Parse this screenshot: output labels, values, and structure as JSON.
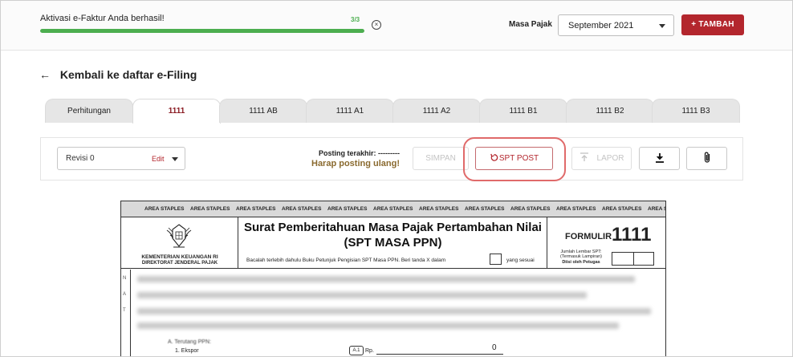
{
  "notification": {
    "message": "Aktivasi e-Faktur Anda berhasil!",
    "step_count": "3/3",
    "progress": 1.0
  },
  "header": {
    "masa_pajak_label": "Masa Pajak",
    "masa_pajak_value": "September  2021",
    "tambah_label": "TAMBAH",
    "tambah_icon": "+"
  },
  "back_link": {
    "arrow": "←",
    "label": "Kembali ke daftar e-Filing"
  },
  "tabs": [
    {
      "label": "Perhitungan",
      "active": false
    },
    {
      "label": "1111",
      "active": true
    },
    {
      "label": "1111 AB",
      "active": false
    },
    {
      "label": "1111 A1",
      "active": false
    },
    {
      "label": "1111 A2",
      "active": false
    },
    {
      "label": "1111 B1",
      "active": false
    },
    {
      "label": "1111 B2",
      "active": false
    },
    {
      "label": "1111 B3",
      "active": false
    }
  ],
  "toolbar": {
    "revisi_value": "Revisi 0",
    "revisi_edit": "Edit",
    "posting_label": "Posting terakhir: ---------",
    "posting_warning": "Harap posting ulang!",
    "simpan_label": "SIMPAN",
    "sptpost_label": "SPT POST",
    "lapor_label": "LAPOR"
  },
  "document": {
    "staple_label": "AREA STAPLES",
    "ministry_line1": "KEMENTERIAN KEUANGAN RI",
    "ministry_line2": "DIREKTORAT JENDERAL PAJAK",
    "title_line1": "Surat Pemberitahuan Masa Pajak Pertambahan Nilai",
    "title_line2": "(SPT MASA PPN)",
    "instruction": "Bacalah terlebih dahulu Buku Petunjuk Pengisian SPT Masa PPN. Beri tanda X  dalam",
    "instruction_end": "yang sesuai",
    "formulir_label": "FORMULIR",
    "formulir_number": "1111",
    "jumlah_line1": "Jumlah Lembar SPT:",
    "jumlah_line2": "(Termasuk Lampiran)",
    "jumlah_line3": "Diisi oleh Petugas",
    "section_terutang": "A. Terutang PPN:",
    "item_ekspor": "1. Ekspor",
    "item_code": "A.1",
    "currency": "Rp.",
    "item_value": "0",
    "left_letters": [
      "N",
      "A",
      "T"
    ],
    "vertical_label": "Ekspor"
  }
}
